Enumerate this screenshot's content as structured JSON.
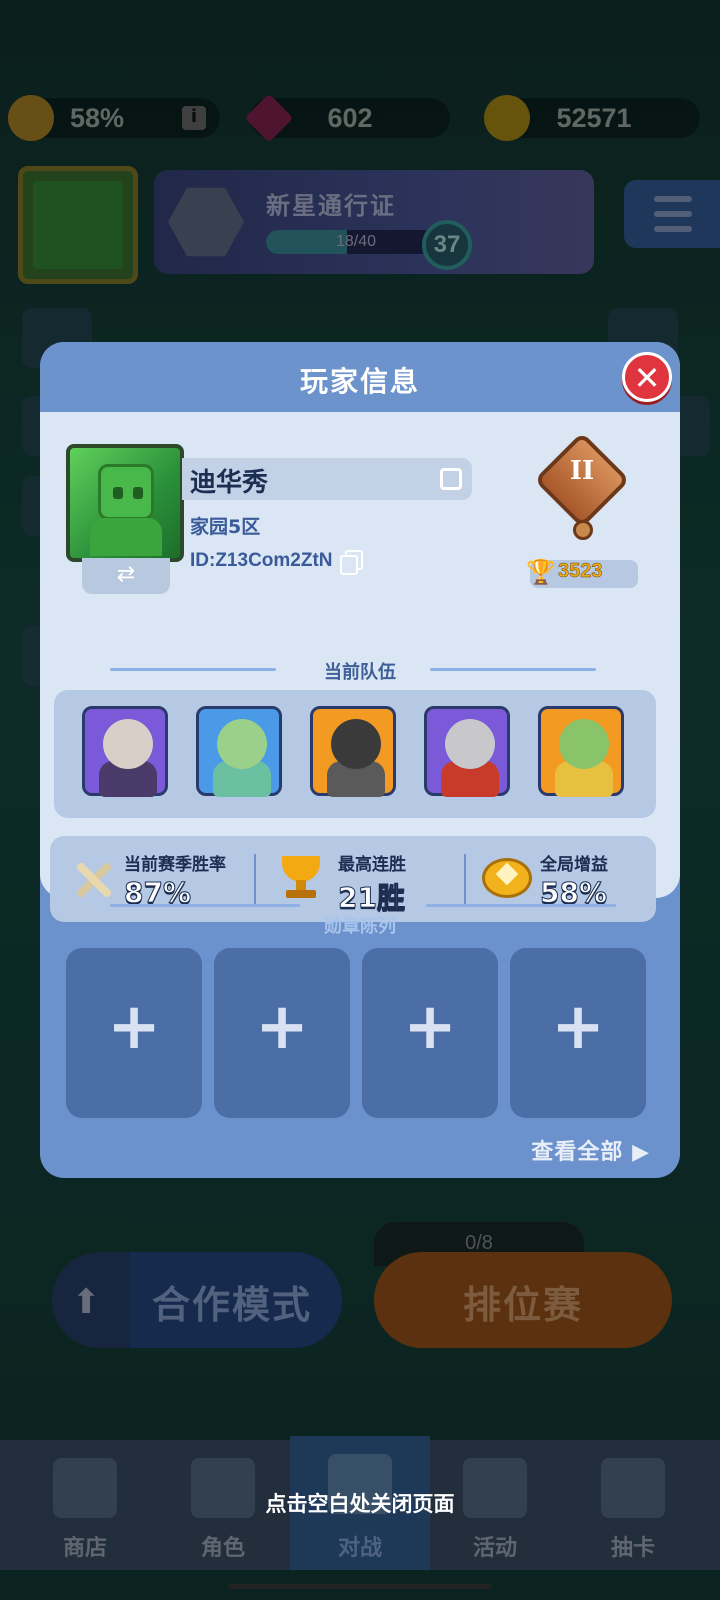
{
  "resources": {
    "boost_percent": "58%",
    "gems": "602",
    "coins": "52571"
  },
  "pass": {
    "title": "新星通行证",
    "progress_text": "18/40",
    "progress": 0.45,
    "level": "37"
  },
  "main": {
    "coop_mode_label": "合作模式",
    "ranked_label": "排位赛",
    "ranked_count": "0/8"
  },
  "bottom_nav": {
    "shop": "商店",
    "characters": "角色",
    "battle": "对战",
    "events": "活动",
    "gacha": "抽卡"
  },
  "modal": {
    "title": "玩家信息",
    "close_icon": "close-icon",
    "player": {
      "name": "迪华秀",
      "server": "家园5区",
      "id": "ID:Z13Com2ZtN",
      "rank_numeral": "II",
      "trophies": "3523"
    },
    "team_label": "当前队伍",
    "team": [
      {
        "name": "dark-knight-hero",
        "color": "#7a5ad8"
      },
      {
        "name": "forest-girl-hero",
        "color": "#4a9ae8"
      },
      {
        "name": "black-armor-hero",
        "color": "#f29a22"
      },
      {
        "name": "red-knight-hero",
        "color": "#7a5ad8"
      },
      {
        "name": "cactus-king-hero",
        "color": "#f29a22"
      }
    ],
    "stats": {
      "win_rate_label": "当前赛季胜率",
      "win_rate_value": "87%",
      "streak_label": "最高连胜",
      "streak_value": "21胜",
      "boost_label": "全局增益",
      "boost_value": "58%"
    },
    "medal_label": "勋章陈列",
    "medal_slot_symbol": "+",
    "view_all": "查看全部 ▶"
  },
  "close_hint": "点击空白处关闭页面",
  "colors": {
    "modal_blue": "#6b92cc",
    "card_bg": "#dbe6f4",
    "close_red": "#e0343e",
    "trophy_gold": "#f2a912"
  }
}
